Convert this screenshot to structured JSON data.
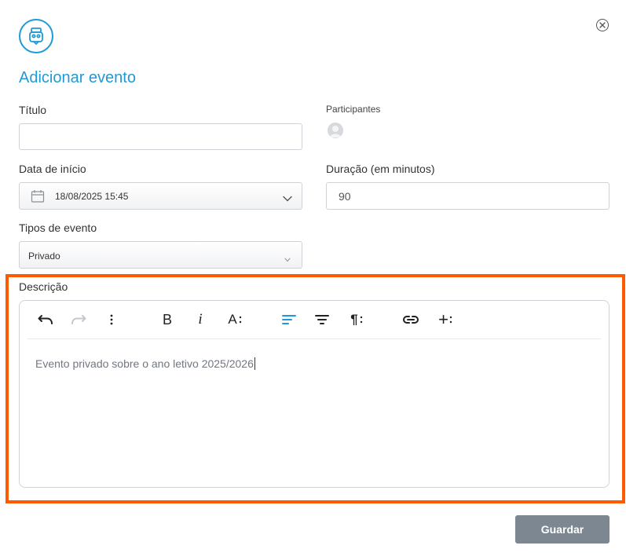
{
  "dialog": {
    "title": "Adicionar evento",
    "accent_color": "#1e9ad6",
    "highlight_color": "#ff5a00"
  },
  "form": {
    "title_label": "Título",
    "title_value": "",
    "participants_label": "Participantes",
    "start_date_label": "Data de início",
    "start_date_value": "18/08/2025 15:45",
    "duration_label": "Duração (em minutos)",
    "duration_value": "90",
    "event_type_label": "Tipos de evento",
    "event_type_value": "Privado",
    "description_label": "Descrição",
    "description_value": "Evento privado sobre o ano letivo 2025/2026"
  },
  "toolbar": {
    "bold": "B",
    "italic": "i",
    "font_size": "A",
    "paragraph": "¶",
    "insert_more": "+"
  },
  "actions": {
    "save_label": "Guardar"
  }
}
